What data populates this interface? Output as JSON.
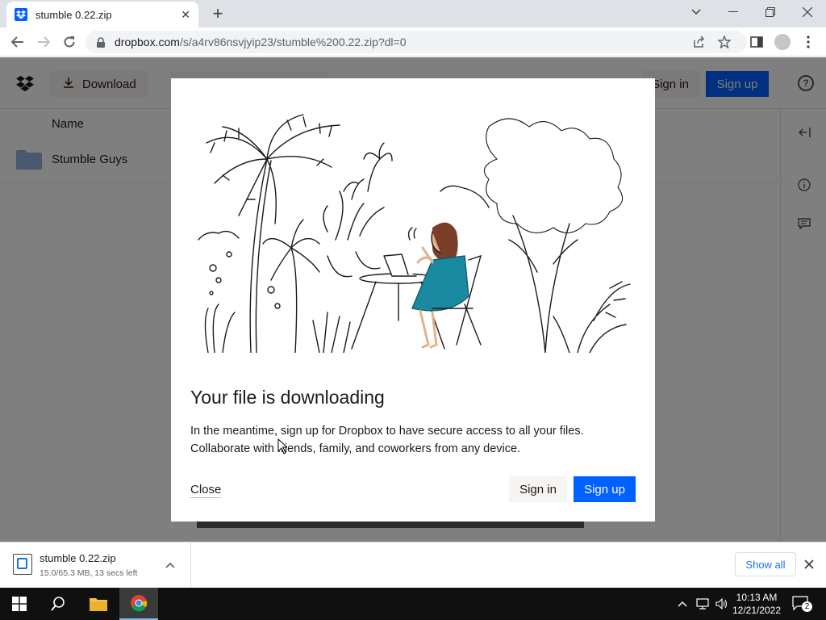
{
  "browser": {
    "tab_title": "stumble 0.22.zip",
    "tab_close": "✕",
    "new_tab": "+",
    "url_domain": "dropbox.com",
    "url_path": "/s/a4rv86nsvjyip23/stumble%200.22.zip?dl=0"
  },
  "page": {
    "download_label": "Download",
    "signin_label": "Sign in",
    "signup_label": "Sign up",
    "column_name": "Name",
    "rows": [
      {
        "name": "Stumble Guys"
      }
    ]
  },
  "modal": {
    "title": "Your file is downloading",
    "body_line1": "In the meantime, sign up for Dropbox to have secure access to all your files.",
    "body_line2": "Collaborate with friends, family, and coworkers from any device.",
    "close_label": "Close",
    "signin_label": "Sign in",
    "signup_label": "Sign up"
  },
  "download_bar": {
    "file_name": "stumble 0.22.zip",
    "status": "15.0/65.3 MB, 13 secs left",
    "show_all": "Show all"
  },
  "taskbar": {
    "time": "10:13 AM",
    "date": "12/21/2022",
    "notification_count": "2"
  },
  "colors": {
    "accent": "#0061fe",
    "chrome_blue": "#1a73e8",
    "dress": "#1a8aa0"
  }
}
